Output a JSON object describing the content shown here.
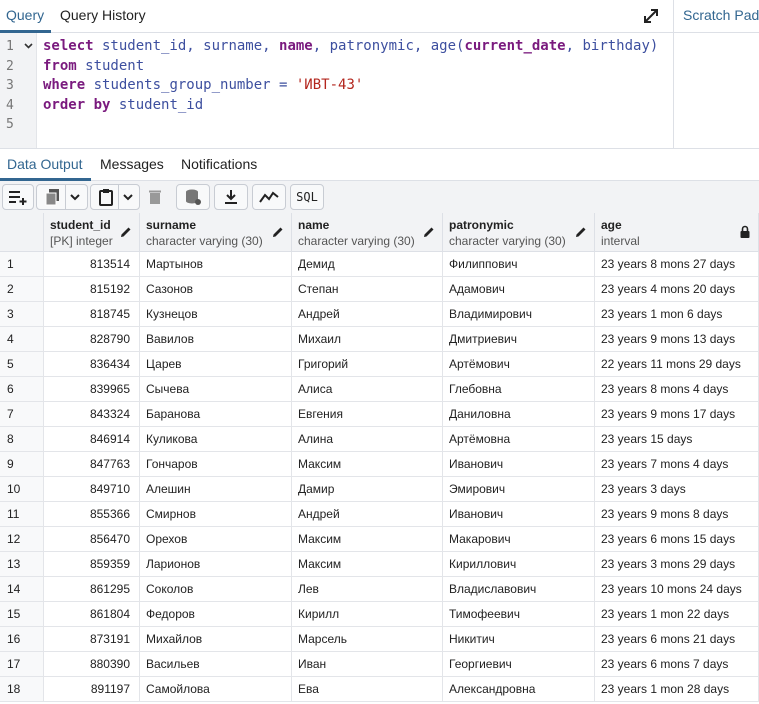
{
  "tabs": {
    "query": "Query",
    "history": "Query History",
    "scratch": "Scratch Pad"
  },
  "editor": {
    "line_numbers": [
      "1",
      "2",
      "3",
      "4",
      "5"
    ],
    "lines": [
      [
        [
          "kw",
          "select"
        ],
        [
          "plain",
          " student_id, surname, "
        ],
        [
          "kw",
          "name"
        ],
        [
          "plain",
          ", patronymic, age("
        ],
        [
          "fn",
          "current_date"
        ],
        [
          "plain",
          ", birthday)"
        ]
      ],
      [
        [
          "kw",
          "from"
        ],
        [
          "plain",
          " student"
        ]
      ],
      [
        [
          "kw",
          "where"
        ],
        [
          "plain",
          " students_group_number = "
        ],
        [
          "str",
          "'ИВТ-43'"
        ]
      ],
      [
        [
          "kw",
          "order by"
        ],
        [
          "plain",
          " student_id"
        ]
      ],
      []
    ]
  },
  "output_tabs": {
    "data": "Data Output",
    "messages": "Messages",
    "notifications": "Notifications"
  },
  "toolbar": {
    "sql_label": "SQL"
  },
  "columns": [
    {
      "name": "student_id",
      "type": "[PK] integer",
      "icon": "pencil-icon"
    },
    {
      "name": "surname",
      "type": "character varying (30)",
      "icon": "pencil-icon"
    },
    {
      "name": "name",
      "type": "character varying (30)",
      "icon": "pencil-icon"
    },
    {
      "name": "patronymic",
      "type": "character varying (30)",
      "icon": "pencil-icon"
    },
    {
      "name": "age",
      "type": "interval",
      "icon": "lock-icon"
    }
  ],
  "rows": [
    [
      "1",
      "813514",
      "Мартынов",
      "Демид",
      "Филиппович",
      "23 years 8 mons 27 days"
    ],
    [
      "2",
      "815192",
      "Сазонов",
      "Степан",
      "Адамович",
      "23 years 4 mons 20 days"
    ],
    [
      "3",
      "818745",
      "Кузнецов",
      "Андрей",
      "Владимирович",
      "23 years 1 mon 6 days"
    ],
    [
      "4",
      "828790",
      "Вавилов",
      "Михаил",
      "Дмитриевич",
      "23 years 9 mons 13 days"
    ],
    [
      "5",
      "836434",
      "Царев",
      "Григорий",
      "Артёмович",
      "22 years 11 mons 29 days"
    ],
    [
      "6",
      "839965",
      "Сычева",
      "Алиса",
      "Глебовна",
      "23 years 8 mons 4 days"
    ],
    [
      "7",
      "843324",
      "Баранова",
      "Евгения",
      "Даниловна",
      "23 years 9 mons 17 days"
    ],
    [
      "8",
      "846914",
      "Куликова",
      "Алина",
      "Артёмовна",
      "23 years 15 days"
    ],
    [
      "9",
      "847763",
      "Гончаров",
      "Максим",
      "Иванович",
      "23 years 7 mons 4 days"
    ],
    [
      "10",
      "849710",
      "Алешин",
      "Дамир",
      "Эмирович",
      "23 years 3 days"
    ],
    [
      "11",
      "855366",
      "Смирнов",
      "Андрей",
      "Иванович",
      "23 years 9 mons 8 days"
    ],
    [
      "12",
      "856470",
      "Орехов",
      "Максим",
      "Макарович",
      "23 years 6 mons 15 days"
    ],
    [
      "13",
      "859359",
      "Ларионов",
      "Максим",
      "Кириллович",
      "23 years 3 mons 29 days"
    ],
    [
      "14",
      "861295",
      "Соколов",
      "Лев",
      "Владиславович",
      "23 years 10 mons 24 days"
    ],
    [
      "15",
      "861804",
      "Федоров",
      "Кирилл",
      "Тимофеевич",
      "23 years 1 mon 22 days"
    ],
    [
      "16",
      "873191",
      "Михайлов",
      "Марсель",
      "Никитич",
      "23 years 6 mons 21 days"
    ],
    [
      "17",
      "880390",
      "Васильев",
      "Иван",
      "Георгиевич",
      "23 years 6 mons 7 days"
    ],
    [
      "18",
      "891197",
      "Самойлова",
      "Ева",
      "Александровна",
      "23 years 1 mon 28 days"
    ]
  ]
}
